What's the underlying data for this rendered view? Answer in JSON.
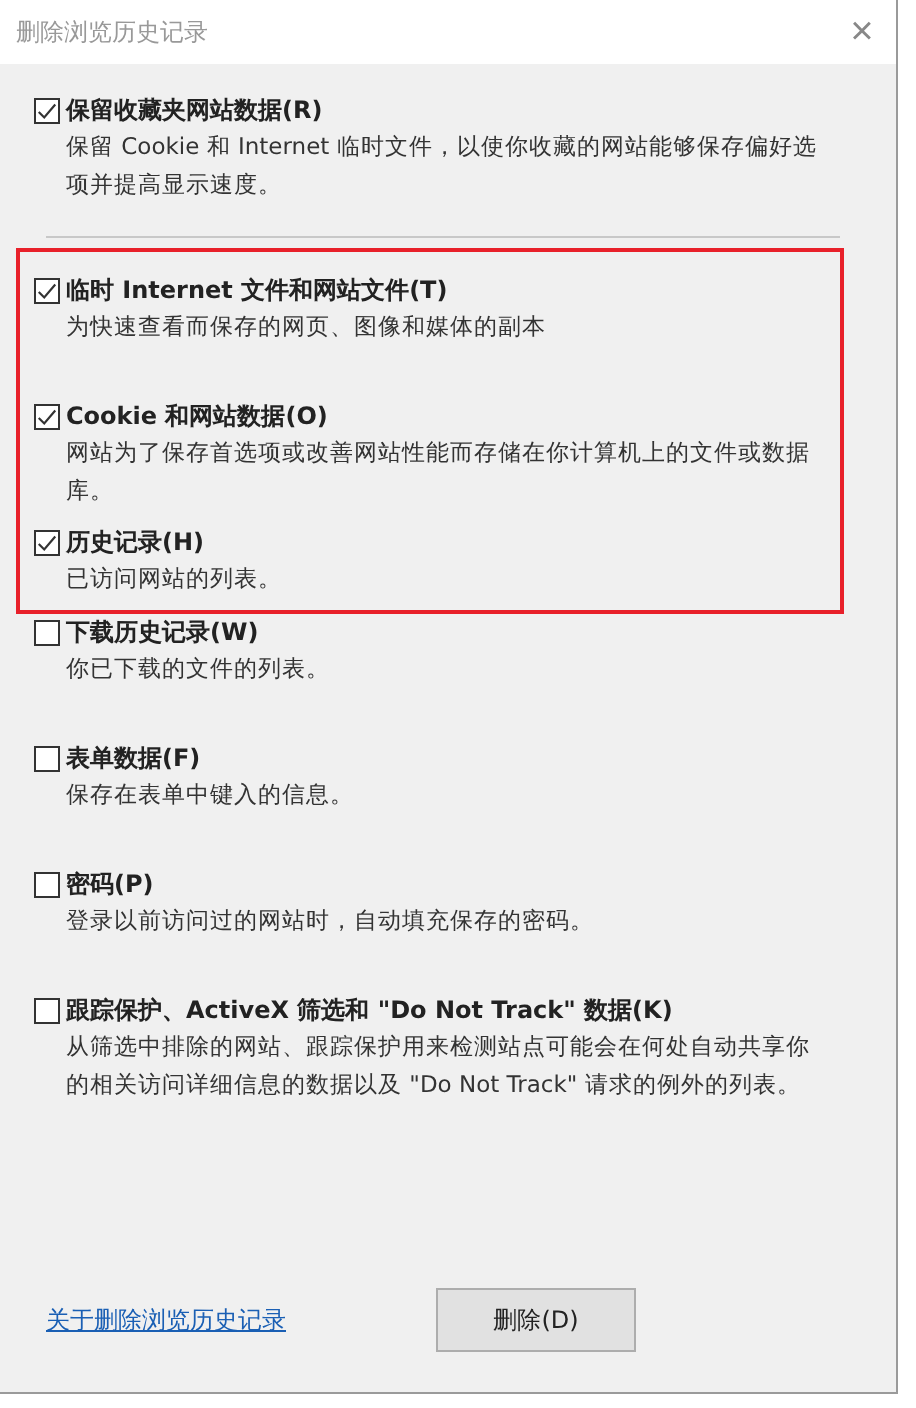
{
  "window": {
    "title": "删除浏览历史记录",
    "close": "×"
  },
  "sections": [
    {
      "highlighted": false,
      "options": [
        {
          "label": "保留收藏夹网站数据(R)",
          "checked": true,
          "description": "保留 Cookie 和 Internet 临时文件，以使你收藏的网站能够保存偏好选项并提高显示速度。"
        }
      ]
    },
    {
      "highlighted": true,
      "options": [
        {
          "label": "临时 Internet 文件和网站文件(T)",
          "checked": true,
          "description": "为快速查看而保存的网页、图像和媒体的副本"
        },
        {
          "label": "Cookie 和网站数据(O)",
          "checked": true,
          "description": "网站为了保存首选项或改善网站性能而存储在你计算机上的文件或数据库。"
        },
        {
          "label": "历史记录(H)",
          "checked": true,
          "description": "已访问网站的列表。"
        }
      ]
    },
    {
      "highlighted": false,
      "options": [
        {
          "label": "下载历史记录(W)",
          "checked": false,
          "description": "你已下载的文件的列表。"
        },
        {
          "label": "表单数据(F)",
          "checked": false,
          "description": "保存在表单中键入的信息。"
        },
        {
          "label": "密码(P)",
          "checked": false,
          "description": "登录以前访问过的网站时，自动填充保存的密码。"
        },
        {
          "label": "跟踪保护、ActiveX 筛选和 \"Do Not Track\" 数据(K)",
          "checked": false,
          "description": "从筛选中排除的网站、跟踪保护用来检测站点可能会在何处自动共享你的相关访问详细信息的数据以及 \"Do Not Track\" 请求的例外的列表。"
        }
      ]
    }
  ],
  "footer": {
    "link": "关于删除浏览历史记录",
    "buttons": [
      "删除(D)"
    ]
  }
}
